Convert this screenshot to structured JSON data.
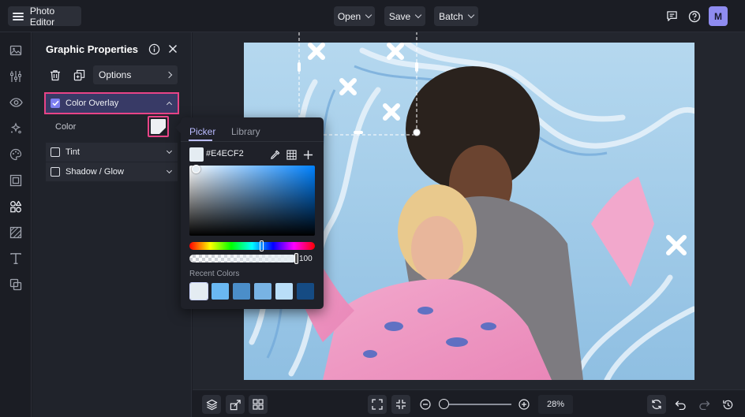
{
  "app": {
    "title": "Photo Editor"
  },
  "menu": [
    {
      "label": "Open"
    },
    {
      "label": "Save"
    },
    {
      "label": "Batch"
    }
  ],
  "user": {
    "avatar_initial": "M"
  },
  "panel": {
    "title": "Graphic Properties",
    "options_label": "Options",
    "color_overlay": {
      "label": "Color Overlay",
      "checked": true,
      "expanded": true,
      "color_label": "Color"
    },
    "tint": {
      "label": "Tint",
      "checked": false
    },
    "shadow": {
      "label": "Shadow / Glow",
      "checked": false
    }
  },
  "picker": {
    "tabs": [
      "Picker",
      "Library"
    ],
    "active_tab": "Picker",
    "hex": "#E4ECF2",
    "alpha": "100",
    "recent_label": "Recent Colors",
    "recent_colors": [
      "#e4ecf2",
      "#6ab8f2",
      "#4b8ec9",
      "#78b3e4",
      "#b9def8",
      "#154b83"
    ],
    "hue_color": "#0082ff"
  },
  "zoom": {
    "value": "28%"
  },
  "colors": {
    "accent": "#e84487",
    "brand": "#8f8cf0",
    "panel": "#20232b"
  }
}
